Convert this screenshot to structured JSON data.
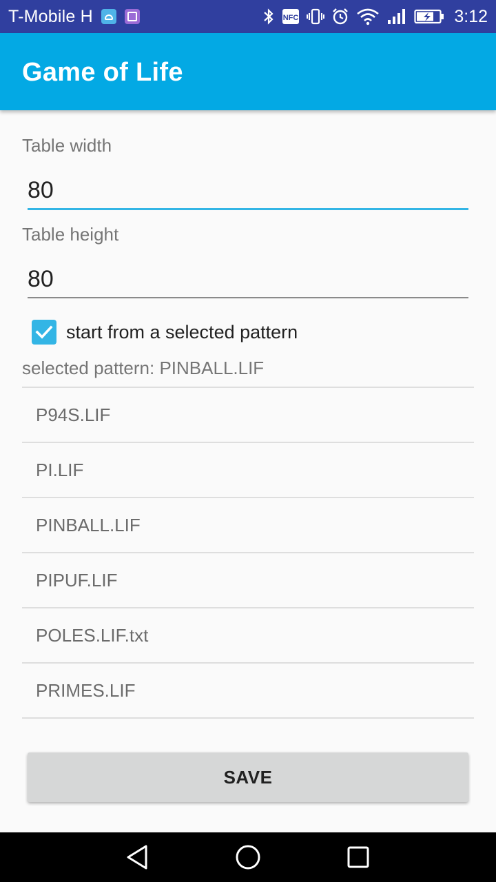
{
  "status_bar": {
    "carrier": "T-Mobile H",
    "time": "3:12",
    "nfc_label": "NFC",
    "icons": [
      "android-notification-icon",
      "gallery-notification-icon",
      "bluetooth-icon",
      "nfc-icon",
      "vibrate-icon",
      "alarm-icon",
      "wifi-icon",
      "signal-icon",
      "battery-charging-icon"
    ]
  },
  "app_bar": {
    "title": "Game of Life",
    "color": "#03a9e4"
  },
  "form": {
    "width_label": "Table width",
    "width_value": "80",
    "height_label": "Table height",
    "height_value": "80",
    "checkbox_label": "start from a selected pattern",
    "checkbox_checked": true,
    "selected_pattern": "selected pattern: PINBALL.LIF"
  },
  "patterns": [
    "P94S.LIF",
    "PI.LIF",
    "PINBALL.LIF",
    "PIPUF.LIF",
    "POLES.LIF.txt",
    "PRIMES.LIF"
  ],
  "actions": {
    "save_label": "SAVE"
  },
  "nav_bar": {
    "icons": [
      "back-icon",
      "home-icon",
      "recents-icon"
    ]
  },
  "colors": {
    "status_bar": "#303f9f",
    "accent": "#33b5e5",
    "background": "#fafafa"
  }
}
